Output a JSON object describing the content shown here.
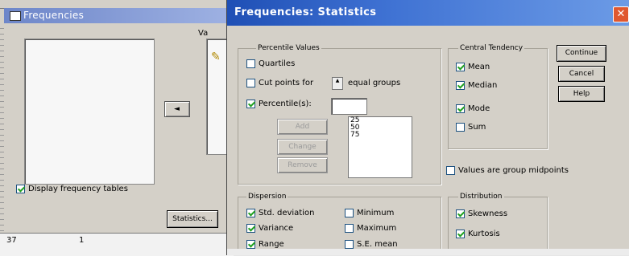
{
  "background_window": {
    "title": "Frequencies",
    "variables_header": "Va",
    "move_arrow": "◄",
    "display_frequency_tables": {
      "label": "Display frequency tables",
      "checked": true
    },
    "statistics_button": "Statistics...",
    "statusbar": {
      "left": "37",
      "mid": "1"
    }
  },
  "dialog": {
    "title": "Frequencies: Statistics",
    "close_glyph": "✕",
    "percentile_values": {
      "title": "Percentile Values",
      "quartiles": {
        "label": "Quartiles",
        "checked": false
      },
      "cut_points": {
        "label": "Cut points for",
        "checked": false,
        "suffix": "equal groups"
      },
      "percentiles": {
        "label": "Percentile(s):",
        "checked": true,
        "input_value": ""
      },
      "buttons": {
        "add": "Add",
        "change": "Change",
        "remove": "Remove"
      },
      "list": [
        "25",
        "50",
        "75"
      ]
    },
    "central_tendency": {
      "title": "Central Tendency",
      "items": [
        {
          "label": "Mean",
          "checked": true
        },
        {
          "label": "Median",
          "checked": true
        },
        {
          "label": "Mode",
          "checked": true
        },
        {
          "label": "Sum",
          "checked": false
        }
      ]
    },
    "values_are_midpoints": {
      "label": "Values are group midpoints",
      "checked": false
    },
    "dispersion": {
      "title": "Dispersion",
      "items": [
        {
          "label": "Std. deviation",
          "checked": true
        },
        {
          "label": "Minimum",
          "checked": false
        },
        {
          "label": "Variance",
          "checked": true
        },
        {
          "label": "Maximum",
          "checked": false
        },
        {
          "label": "Range",
          "checked": true
        },
        {
          "label": "S.E. mean",
          "checked": false
        }
      ]
    },
    "distribution": {
      "title": "Distribution",
      "items": [
        {
          "label": "Skewness",
          "checked": true
        },
        {
          "label": "Kurtosis",
          "checked": true
        }
      ]
    },
    "actions": {
      "continue": "Continue",
      "cancel": "Cancel",
      "help": "Help"
    }
  }
}
